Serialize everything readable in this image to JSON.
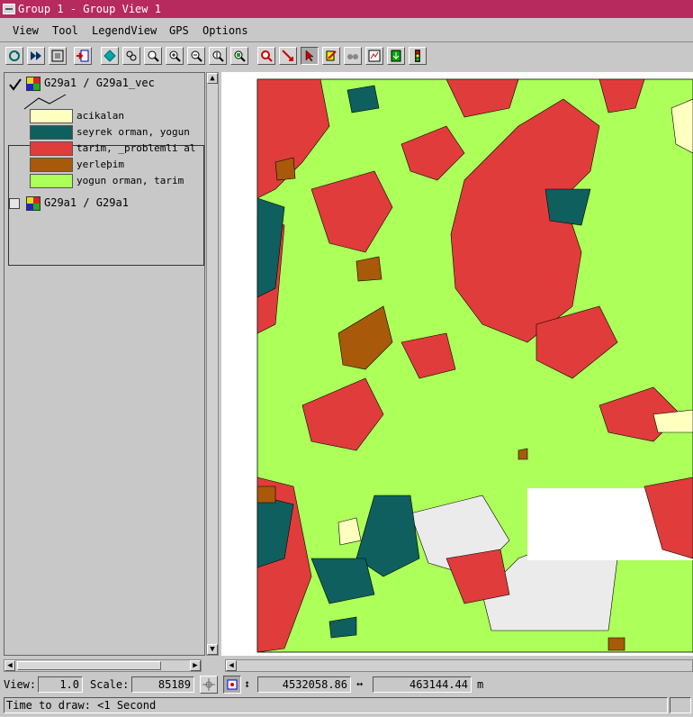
{
  "window": {
    "title": "Group 1 - Group View 1"
  },
  "menu": [
    "View",
    "Tool",
    "LegendView",
    "GPS",
    "Options"
  ],
  "toolbar_icons": [
    "redraw-icon",
    "fast-redraw-icon",
    "full-view-icon",
    "add-layer-icon",
    "layer-manager-icon",
    "zoom-level-icon",
    "fit-icon",
    "zoom-in-icon",
    "zoom-out-icon",
    "zoom-1x-icon",
    "zoom-box-icon",
    "zoom-target-icon",
    "measure-icon",
    "select-arrow-icon",
    "edit-icon",
    "binoculars-icon",
    "print-layout-icon",
    "save-icon",
    "traffic-light-icon"
  ],
  "layers": [
    {
      "checked": true,
      "name": "G29a1 / G29a1_vec"
    },
    {
      "checked": false,
      "name": "G29a1 / G29a1"
    }
  ],
  "legend": [
    {
      "label": "acikalan",
      "color": "#ffffc0"
    },
    {
      "label": "seyrek orman, yogun",
      "color": "#0f5f5f"
    },
    {
      "label": "tarim, _problemli al",
      "color": "#e03c3c"
    },
    {
      "label": "yerleþim",
      "color": "#a85a0a"
    },
    {
      "label": "yogun orman, tarim",
      "color": "#adff5a"
    }
  ],
  "colors": {
    "title_bg": "#b62a5e",
    "land": "#adff5a",
    "agri": "#e03c3c",
    "forest": "#0f5f5f",
    "settle": "#a85a0a",
    "open": "#ffffc0",
    "empty": "#ebebeb"
  },
  "status": {
    "view_label": "View:",
    "view_value": "1.0",
    "scale_label": "Scale:",
    "scale_value": "85189",
    "northing": "4532058.86",
    "easting": "463144.44",
    "unit": "m",
    "message": "Time to draw: <1 Second"
  }
}
